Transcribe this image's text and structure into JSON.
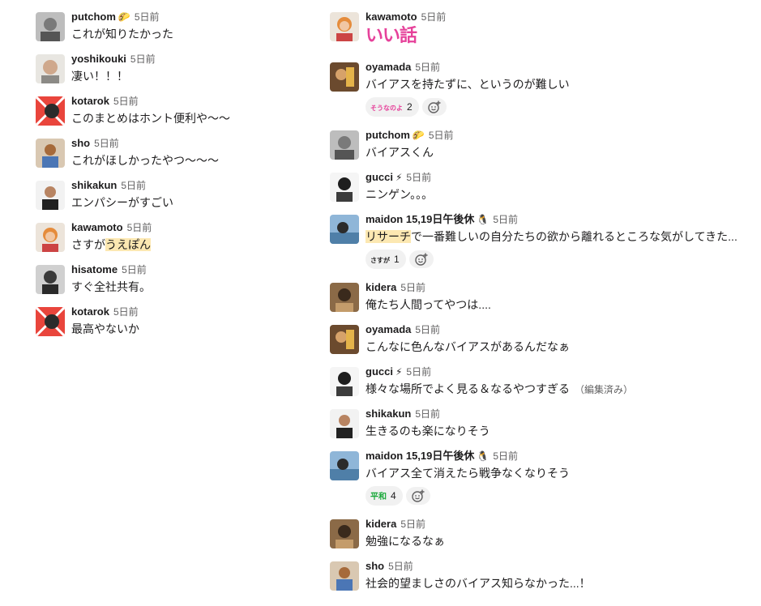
{
  "left_messages": [
    {
      "user": "putchom",
      "status": "🌮",
      "time": "5日前",
      "text": "これが知りたかった",
      "avatar": "grayscale-portrait"
    },
    {
      "user": "yoshikouki",
      "status": "",
      "time": "5日前",
      "text": "凄い！！！",
      "avatar": "smiling-portrait"
    },
    {
      "user": "kotarok",
      "status": "",
      "time": "5日前",
      "text": "このまとめはホント便利や〜〜",
      "avatar": "red-x-portrait"
    },
    {
      "user": "sho",
      "status": "",
      "time": "5日前",
      "text": "これがほしかったやつ〜〜〜",
      "avatar": "photo-portrait"
    },
    {
      "user": "shikakun",
      "status": "",
      "time": "5日前",
      "text": "エンパシーがすごい",
      "avatar": "headshot-portrait"
    },
    {
      "user": "kawamoto",
      "status": "",
      "time": "5日前",
      "text_before": "さすが",
      "text_highlight": "うえぽん",
      "text_after": "",
      "avatar": "orange-hair-portrait"
    },
    {
      "user": "hisatome",
      "status": "",
      "time": "5日前",
      "text": "すぐ全社共有。",
      "avatar": "dark-portrait"
    },
    {
      "user": "kotarok",
      "status": "",
      "time": "5日前",
      "text": "最高やないか",
      "avatar": "red-x-portrait"
    }
  ],
  "right_messages": [
    {
      "user": "kawamoto",
      "status": "",
      "time": "5日前",
      "stamp": "いい話",
      "avatar": "orange-hair-portrait"
    },
    {
      "user": "oyamada",
      "status": "",
      "time": "5日前",
      "text": "バイアスを持たずに、というのが難しい",
      "avatar": "warm-photo-portrait",
      "reactions": [
        {
          "emoji": "そうなのよ",
          "count": "2"
        }
      ]
    },
    {
      "user": "putchom",
      "status": "🌮",
      "time": "5日前",
      "text": "バイアスくん",
      "avatar": "grayscale-portrait"
    },
    {
      "user": "gucci",
      "status": "⚡",
      "time": "5日前",
      "text": "ニンゲン。。。",
      "avatar": "bw-portrait"
    },
    {
      "user": "maidon 15,19日午後休",
      "status": "🐧",
      "time": "5日前",
      "text_before": "",
      "text_highlight": "リサーチ",
      "text_after": "で一番難しいの自分たちの欲から離れるところな気がしてきた...",
      "avatar": "sky-portrait",
      "reactions": [
        {
          "emoji": "さすが",
          "count": "1"
        }
      ]
    },
    {
      "user": "kidera",
      "status": "",
      "time": "5日前",
      "text": "俺たち人間ってやつは....",
      "avatar": "brown-portrait"
    },
    {
      "user": "oyamada",
      "status": "",
      "time": "5日前",
      "text": "こんなに色んなバイアスがあるんだなぁ",
      "avatar": "warm-photo-portrait"
    },
    {
      "user": "gucci",
      "status": "⚡",
      "time": "5日前",
      "text": "様々な場所でよく見る＆なるやつすぎる",
      "edited": "（編集済み）",
      "avatar": "bw-portrait"
    },
    {
      "user": "shikakun",
      "status": "",
      "time": "5日前",
      "text": "生きるのも楽になりそう",
      "avatar": "headshot-portrait"
    },
    {
      "user": "maidon 15,19日午後休",
      "status": "🐧",
      "time": "5日前",
      "text": "バイアス全て消えたら戦争なくなりそう",
      "avatar": "sky-portrait",
      "reactions": [
        {
          "emoji": "平和",
          "count": "4"
        }
      ]
    },
    {
      "user": "kidera",
      "status": "",
      "time": "5日前",
      "text": "勉強になるなぁ",
      "avatar": "brown-portrait"
    },
    {
      "user": "sho",
      "status": "",
      "time": "5日前",
      "text": "社会的望ましさのバイアス知らなかった...！",
      "avatar": "photo-portrait"
    }
  ],
  "colors": {
    "text": "#1d1c1d",
    "muted": "#616061",
    "highlight": "#fce8b2",
    "reaction_bg": "#f1f1f1",
    "stamp": "#e6419a",
    "heiwa": "#1aa83a"
  }
}
